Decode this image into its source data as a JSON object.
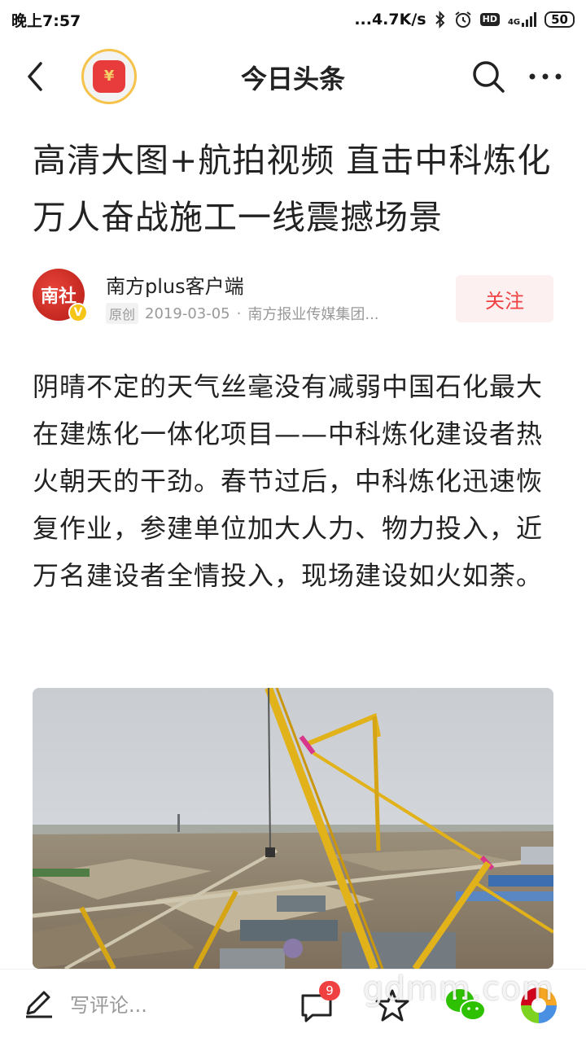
{
  "status_bar": {
    "time": "晚上7:57",
    "network_speed": "...4.7K/s",
    "hd_label": "HD",
    "signal_label": "4G",
    "battery": "50"
  },
  "nav": {
    "title": "今日头条"
  },
  "article": {
    "headline": "高清大图+航拍视频 直击中科炼化万人奋战施工一线震撼场景",
    "author": {
      "name": "南方plus客户端",
      "avatar_text": "南社",
      "verified_badge": "V",
      "original_tag": "原创",
      "date": "2019-03-05",
      "separator": "·",
      "source": "南方报业传媒集团..."
    },
    "follow_label": "关注",
    "body": "阴晴不定的天气丝毫没有减弱中国石化最大在建炼化一体化项目——中科炼化建设者热火朝天的干劲。春节过后，中科炼化迅速恢复作业，参建单位加大人力、物力投入，近万名建设者全情投入，现场建设如火如荼。"
  },
  "bottom_bar": {
    "compose_placeholder": "写评论...",
    "comment_count": "9",
    "watermark": "gdmm.com"
  },
  "icons": {
    "back": "back-arrow-icon",
    "search": "search-icon",
    "more": "more-dots-icon",
    "compose": "pencil-icon",
    "comment": "comment-bubble-icon",
    "favorite": "star-icon",
    "wechat": "wechat-icon",
    "moments": "moments-icon"
  },
  "colors": {
    "accent_red": "#f04142",
    "follow_bg": "#fdf0f0",
    "text_primary": "#222222",
    "text_meta": "#999999"
  }
}
